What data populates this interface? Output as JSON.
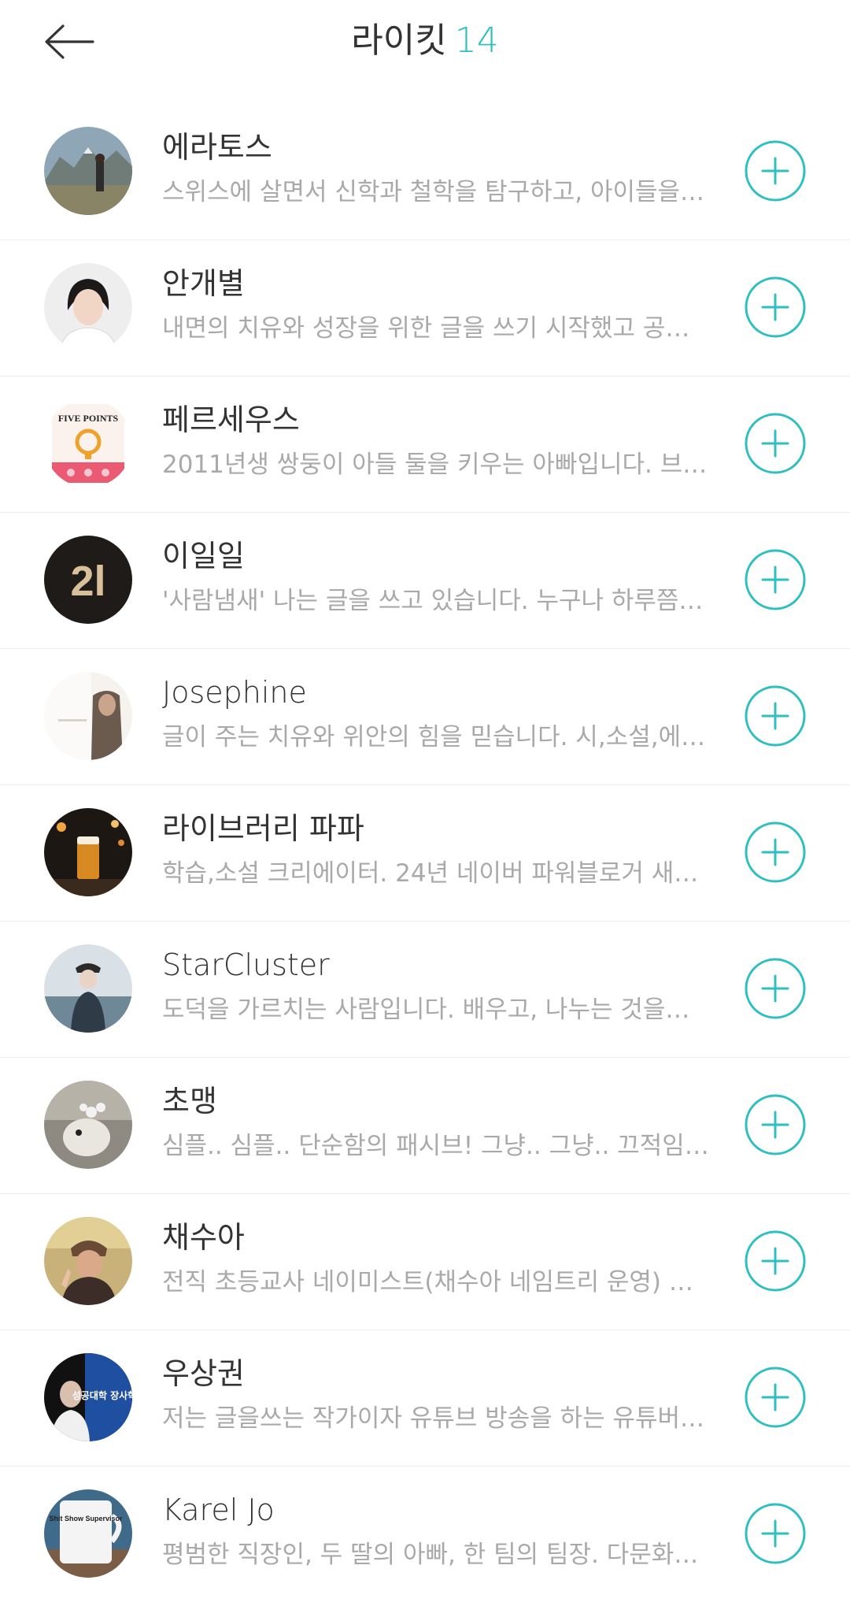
{
  "header": {
    "title": "라이킷",
    "count": "14",
    "back_icon": "arrow-left-icon",
    "accent_color": "#2ebfc1"
  },
  "users": [
    {
      "name": "에라토스",
      "desc": "스위스에 살면서 신학과 철학을 탐구하고, 아이들을…",
      "avatar": "mountain-hiker-photo"
    },
    {
      "name": "안개별",
      "desc": "내면의 치유와 성장을 위한 글을 쓰기 시작했고 공…",
      "avatar": "portrait-woman-photo"
    },
    {
      "name": "페르세우스",
      "desc": "2011년생 쌍둥이 아들 둘을 키우는 아빠입니다. 브…",
      "avatar": "book-cover-five-points"
    },
    {
      "name": "이일일",
      "desc": "'사람냄새' 나는 글을 쓰고 있습니다. 누구나 하루쯤…",
      "avatar": "logo-2-1"
    },
    {
      "name": "Josephine",
      "desc": "글이 주는 치유와 위안의 힘을 믿습니다. 시,소설,에…",
      "avatar": "window-figure-photo"
    },
    {
      "name": "라이브러리 파파",
      "desc": "학습,소설 크리에이터. 24년 네이버 파워블로거 새…",
      "avatar": "beer-bar-photo"
    },
    {
      "name": "StarCluster",
      "desc": "도덕을 가르치는 사람입니다. 배우고, 나누는 것을…",
      "avatar": "person-hat-seaside-photo"
    },
    {
      "name": "초맹",
      "desc": "심플.. 심플.. 단순함의 패시브! 그냥.. 그냥.. 끄적임…",
      "avatar": "figurine-photo"
    },
    {
      "name": "채수아",
      "desc": "전직 초등교사 네이미스트(채수아 네임트리 운영) …",
      "avatar": "woman-beanie-photo"
    },
    {
      "name": "우상권",
      "desc": "저는 글을쓰는 작가이자 유튜브 방송을 하는 유튜버…",
      "avatar": "book-cover-success-university"
    },
    {
      "name": "Karel Jo",
      "desc": "평범한 직장인, 두 딸의 아빠, 한 팀의 팀장. 다문화…",
      "avatar": "mug-photo"
    }
  ],
  "follow_icon": "plus-circle-icon",
  "avatar_texts": {
    "five_points": "FIVE POINTS",
    "logo": "2l",
    "success_book": "성공대학 장사학과",
    "mug": "Shit Show Supervisor"
  }
}
